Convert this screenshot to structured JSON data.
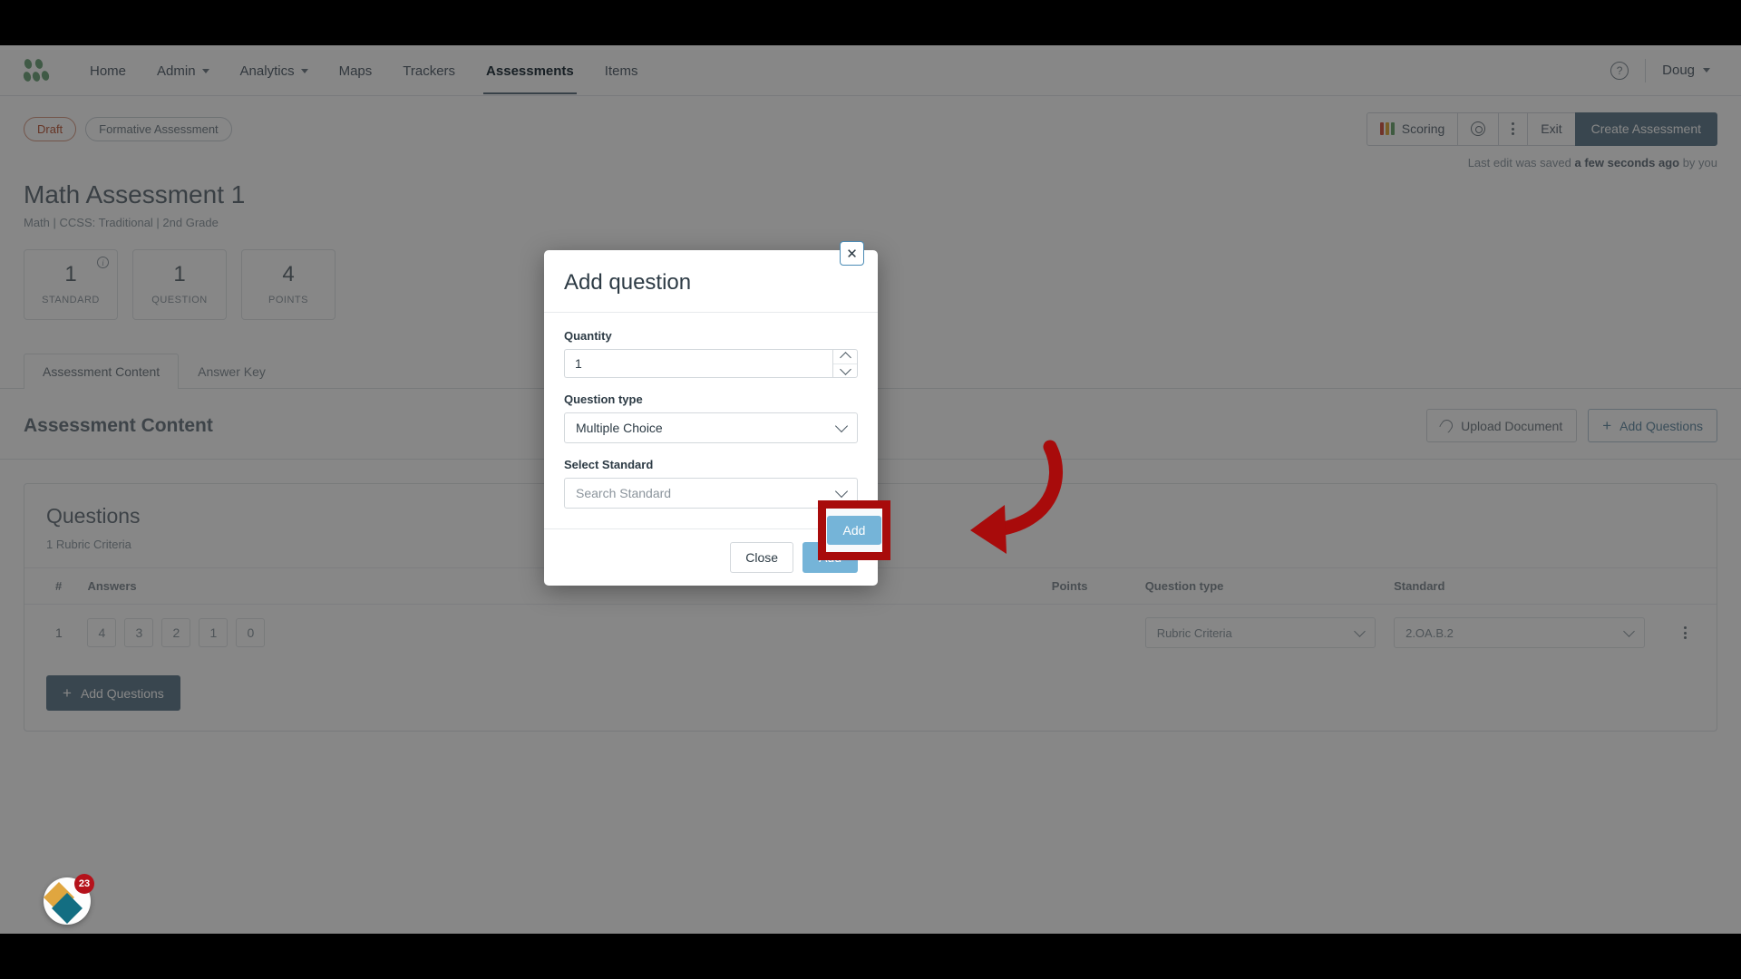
{
  "nav": {
    "logo_icon": "dots-logo-icon",
    "items": [
      {
        "label": "Home",
        "dropdown": false
      },
      {
        "label": "Admin",
        "dropdown": true
      },
      {
        "label": "Analytics",
        "dropdown": true
      },
      {
        "label": "Maps",
        "dropdown": false
      },
      {
        "label": "Trackers",
        "dropdown": false
      },
      {
        "label": "Assessments",
        "dropdown": false
      },
      {
        "label": "Items",
        "dropdown": false
      }
    ],
    "active": "Assessments",
    "help_icon": "question-circle-icon",
    "user": "Doug"
  },
  "statusbar": {
    "draft_pill": "Draft",
    "kind_pill": "Formative Assessment",
    "scoring_label": "Scoring",
    "gear_icon": "gear-icon",
    "kebab_icon": "kebab-menu-icon",
    "exit_label": "Exit",
    "create_label": "Create Assessment",
    "saved_prefix": "Last edit was saved ",
    "saved_when": "a few seconds ago",
    "saved_suffix": " by you"
  },
  "page": {
    "title": "Math Assessment 1",
    "subtitle": "Math | CCSS: Traditional | 2nd Grade",
    "stats": [
      {
        "value": "1",
        "label": "STANDARD",
        "info": true
      },
      {
        "value": "1",
        "label": "QUESTION",
        "info": false
      },
      {
        "value": "4",
        "label": "POINTS",
        "info": false
      }
    ],
    "tabs": [
      {
        "label": "Assessment Content",
        "active": true
      },
      {
        "label": "Answer Key",
        "active": false
      }
    ],
    "content_heading": "Assessment Content",
    "upload_label": "Upload Document",
    "add_questions_label": "Add Questions"
  },
  "questions": {
    "heading": "Questions",
    "subheading": "1 Rubric Criteria",
    "columns": [
      "#",
      "Answers",
      "Points",
      "Question type",
      "Standard"
    ],
    "rows": [
      {
        "num": "1",
        "answers": [
          "4",
          "3",
          "2",
          "1",
          "0"
        ],
        "points": "",
        "question_type": "Rubric Criteria",
        "standard": "2.OA.B.2",
        "row_menu_icon": "kebab-menu-icon"
      }
    ],
    "add_button_label": "Add Questions"
  },
  "widget": {
    "badge_count": "23",
    "icon": "diamond-logo-icon"
  },
  "modal": {
    "title": "Add question",
    "close_icon": "close-icon",
    "quantity_label": "Quantity",
    "quantity_value": "1",
    "stepper_up_icon": "chevron-up-icon",
    "stepper_down_icon": "chevron-down-icon",
    "question_type_label": "Question type",
    "question_type_value": "Multiple Choice",
    "standard_label": "Select Standard",
    "standard_placeholder": "Search Standard",
    "chevron_icon": "chevron-down-icon",
    "close_button": "Close",
    "add_button": "Add"
  },
  "annotation": {
    "highlight_target": "Add",
    "highlight_color": "#a80b0b",
    "arrow_icon": "arrow-pointing-left-icon"
  },
  "colors": {
    "accent_blue": "#75b4d8",
    "primary_button": "#6c8595",
    "draft_orange": "#c1674a",
    "annotation_red": "#a80b0b",
    "logo_green": "#7aab84"
  }
}
